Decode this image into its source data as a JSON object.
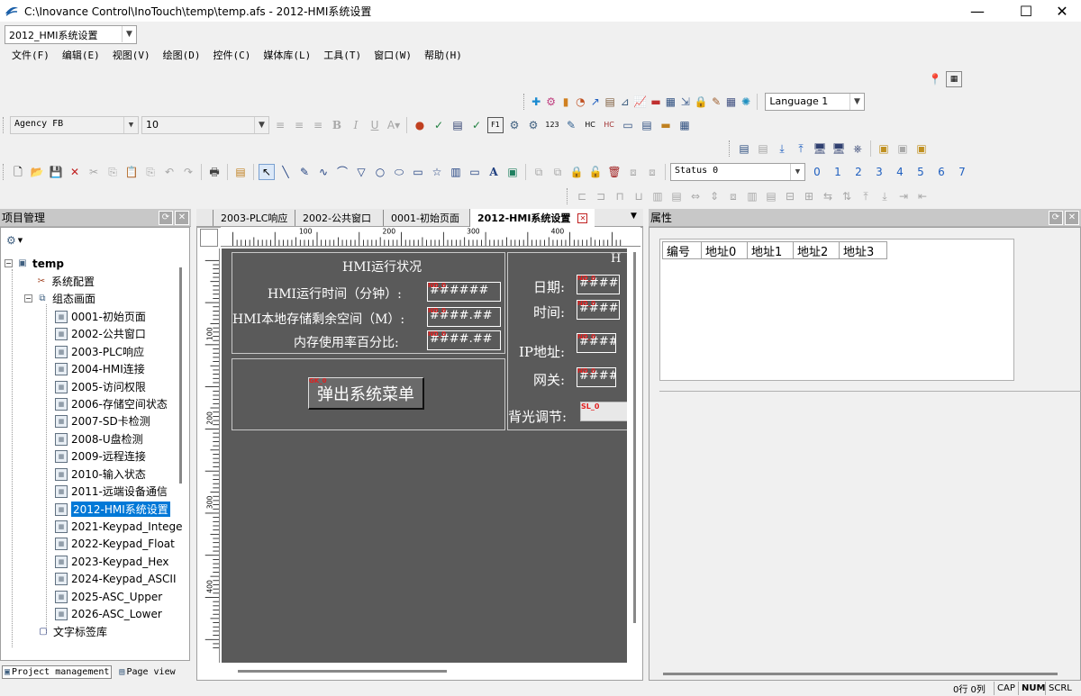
{
  "window": {
    "title": "C:\\Inovance Control\\InoTouch\\temp\\temp.afs - 2012-HMI系统设置",
    "minimize": "—",
    "maximize": "☐",
    "close": "✕"
  },
  "screen_combo": {
    "value": "2012_HMI系统设置"
  },
  "menu": [
    "文件(F)",
    "编辑(E)",
    "视图(V)",
    "绘图(D)",
    "控件(C)",
    "媒体库(L)",
    "工具(T)",
    "窗口(W)",
    "帮助(H)"
  ],
  "toolbar": {
    "language_combo": "Language 1",
    "font_combo": "Agency FB",
    "size_combo": "10",
    "status_combo": "Status 0",
    "status_numbers": [
      "0",
      "1",
      "2",
      "3",
      "4",
      "5",
      "6",
      "7"
    ]
  },
  "project_panel": {
    "title": "项目管理",
    "root": "temp",
    "system_config": "系统配置",
    "group": "组态画面",
    "pages": [
      "0001-初始页面",
      "2002-公共窗口",
      "2003-PLC响应",
      "2004-HMI连接",
      "2005-访问权限",
      "2006-存储空间状态",
      "2007-SD卡检测",
      "2008-U盘检测",
      "2009-远程连接",
      "2010-输入状态",
      "2011-远端设备通信",
      "2012-HMI系统设置",
      "2021-Keypad_Intege",
      "2022-Keypad_Float",
      "2023-Keypad_Hex",
      "2024-Keypad_ASCII",
      "2025-ASC_Upper",
      "2026-ASC_Lower"
    ],
    "text_tags": "文字标签库",
    "bottom_tabs": [
      "Project management",
      "Page view"
    ]
  },
  "editor_tabs": [
    "2003-PLC响应",
    "2002-公共窗口",
    "0001-初始页面",
    "2012-HMI系统设置"
  ],
  "ruler": {
    "h": [
      "100",
      "200",
      "300",
      "400"
    ],
    "v": [
      "100",
      "200",
      "300",
      "400"
    ]
  },
  "hmi": {
    "run_status_title": "HMI运行状况",
    "run_time_label": "HMI运行时间（分钟）:",
    "run_time_value": "######",
    "storage_label": "HMI本地存储剩余空间（M）:",
    "storage_value": "####.##",
    "mem_label": "内存使用率百分比:",
    "mem_value": "####.##",
    "popup_button": "弹出系统菜单",
    "right_title": "H",
    "date_label": "日期:",
    "time_label": "时间:",
    "ip_label": "IP地址:",
    "gateway_label": "网关:",
    "backlight_label": "背光调节:",
    "field_value": "####",
    "tags": {
      "nd": "ND_0",
      "gk": "GK_0",
      "sl": "SL_0"
    }
  },
  "properties_panel": {
    "title": "属性",
    "columns": [
      "编号",
      "地址0",
      "地址1",
      "地址2",
      "地址3"
    ]
  },
  "statusbar": {
    "pos": "0行 0列",
    "cap": "CAP",
    "num": "NUM",
    "scrl": "SCRL"
  }
}
